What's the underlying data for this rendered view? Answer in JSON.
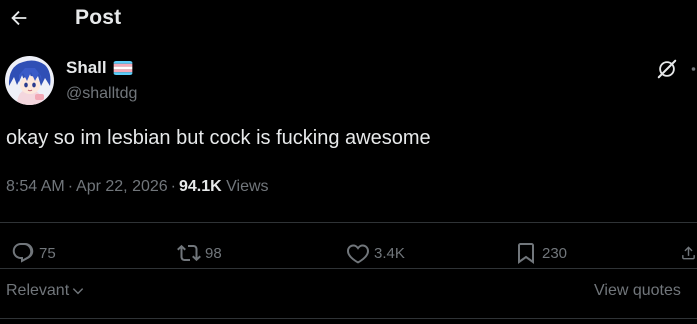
{
  "header": {
    "title": "Post",
    "back_icon": "arrow-left-icon"
  },
  "author": {
    "display_name": "Shall",
    "handle": "@shalltdg",
    "flag_icon": "transgender-flag-icon",
    "avatar_icon": "anime-avatar"
  },
  "post": {
    "text": "okay so im lesbian but cock is fucking awesome",
    "time": "8:54 AM",
    "date": "Apr 22, 2026",
    "separator": "·",
    "views_count": "94.1K",
    "views_label": "Views"
  },
  "actions": {
    "replies": "75",
    "reposts": "98",
    "likes": "3.4K",
    "bookmarks": "230"
  },
  "footer": {
    "sort_label": "Relevant",
    "view_quotes_label": "View quotes"
  },
  "colors": {
    "background": "#000000",
    "primary_text": "#e7e9ea",
    "secondary_text": "#71767b",
    "divider": "#2f3336",
    "flag_blue": "#5bcefa",
    "flag_pink": "#f5a9b8",
    "flag_white": "#ffffff"
  }
}
